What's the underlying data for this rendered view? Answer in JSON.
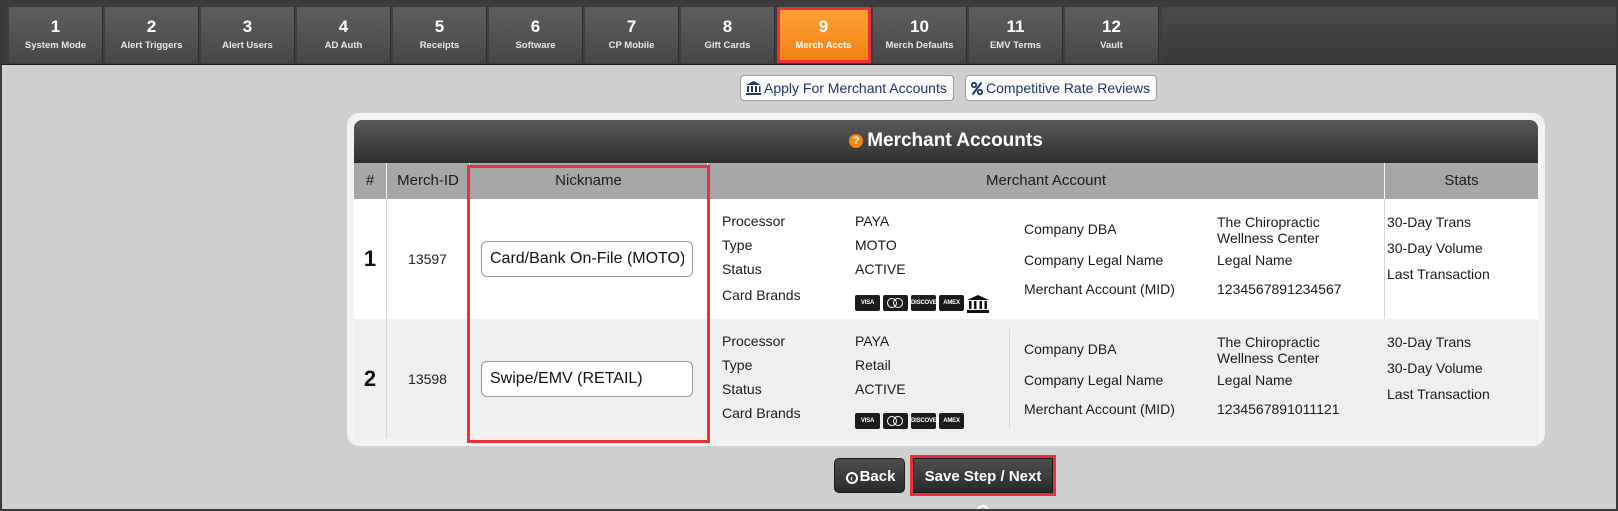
{
  "steps": [
    {
      "num": "1",
      "label": "System Mode"
    },
    {
      "num": "2",
      "label": "Alert Triggers"
    },
    {
      "num": "3",
      "label": "Alert Users"
    },
    {
      "num": "4",
      "label": "AD Auth"
    },
    {
      "num": "5",
      "label": "Receipts"
    },
    {
      "num": "6",
      "label": "Software"
    },
    {
      "num": "7",
      "label": "CP Mobile"
    },
    {
      "num": "8",
      "label": "Gift Cards"
    },
    {
      "num": "9",
      "label": "Merch Accts"
    },
    {
      "num": "10",
      "label": "Merch Defaults"
    },
    {
      "num": "11",
      "label": "EMV Terms"
    },
    {
      "num": "12",
      "label": "Vault"
    }
  ],
  "active_step": "9",
  "links": {
    "apply": "Apply For Merchant Accounts",
    "rates": "Competitive Rate Reviews"
  },
  "panel": {
    "title": "Merchant Accounts",
    "help_icon": "question-circle-icon",
    "headers": {
      "num": "#",
      "merch_id": "Merch-ID",
      "nickname": "Nickname",
      "merchant_account": "Merchant Account",
      "stats": "Stats"
    },
    "labels": {
      "processor": "Processor",
      "type": "Type",
      "status": "Status",
      "card_brands": "Card Brands",
      "company_dba": "Company DBA",
      "company_legal_name": "Company Legal Name",
      "mid": "Merchant Account (MID)",
      "trans30": "30-Day Trans",
      "vol30": "30-Day Volume",
      "last_txn": "Last Transaction"
    },
    "rows": [
      {
        "index": "1",
        "merch_id": "13597",
        "nickname": "Card/Bank On-File (MOTO)",
        "processor": "PAYA",
        "type": "MOTO",
        "status": "ACTIVE",
        "card_brands": [
          "VISA",
          "MC",
          "DISCOVER",
          "AMEX",
          "BANK"
        ],
        "company_dba": "The Chiropractic Wellness Center",
        "company_legal_name": "Legal Name",
        "mid": "1234567891234567"
      },
      {
        "index": "2",
        "merch_id": "13598",
        "nickname": "Swipe/EMV (RETAIL)",
        "processor": "PAYA",
        "type": "Retail",
        "status": "ACTIVE",
        "card_brands": [
          "VISA",
          "MC",
          "DISCOVER",
          "AMEX"
        ],
        "company_dba": "The Chiropractic Wellness Center",
        "company_legal_name": "Legal Name",
        "mid": "1234567891011121"
      }
    ]
  },
  "buttons": {
    "back": "Back",
    "save_next": "Save Step / Next"
  },
  "colors": {
    "accent_orange": "#f5871f",
    "highlight_red": "#e8323a",
    "link_navy": "#1d3763"
  }
}
